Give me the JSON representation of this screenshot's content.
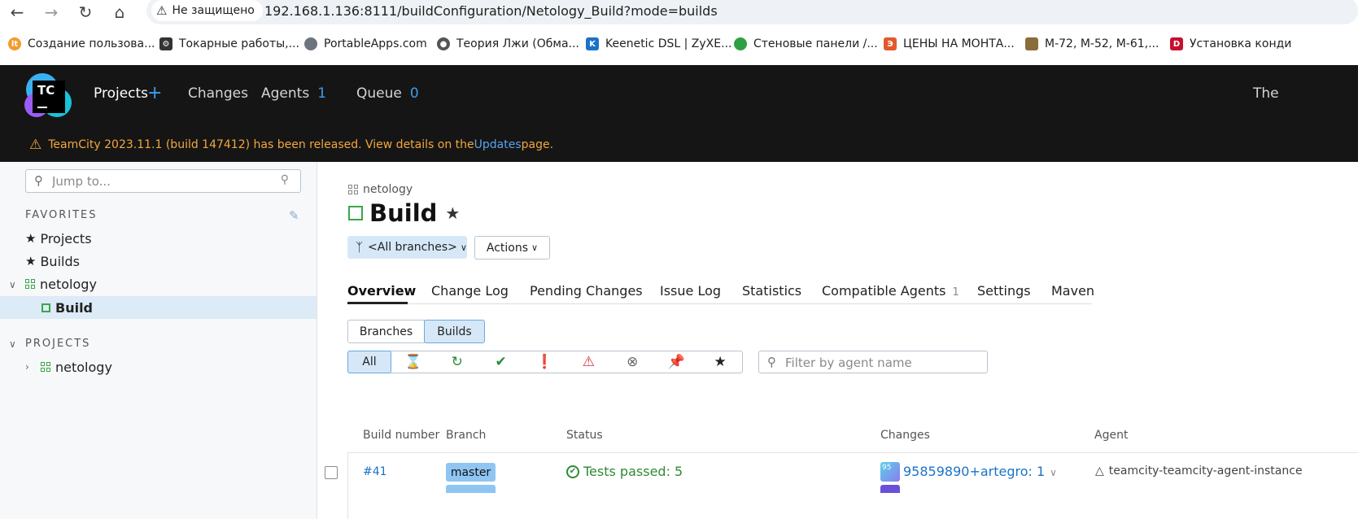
{
  "browser": {
    "security_label": "Не защищено",
    "url": "192.168.1.136:8111/buildConfiguration/Netology_Build?mode=builds",
    "bookmarks": [
      {
        "label": "Создание пользова...",
        "color": "#f39a2b",
        "icon": "lt-icon"
      },
      {
        "label": "Токарные работы,...",
        "color": "#333333",
        "icon": "lathe-icon"
      },
      {
        "label": "PortableApps.com",
        "color": "#6c7480",
        "icon": "portableapps-icon"
      },
      {
        "label": "Теория Лжи (Обма...",
        "color": "#555555",
        "icon": "globe-icon"
      },
      {
        "label": "Keenetic DSL | ZyXE...",
        "color": "#1a73c9",
        "icon": "keenetic-icon"
      },
      {
        "label": "Стеновые панели /...",
        "color": "#2ea043",
        "icon": "panel-icon"
      },
      {
        "label": "ЦЕНЫ НА МОНТА...",
        "color": "#e2592b",
        "icon": "price-icon"
      },
      {
        "label": "М-72, М-52, М-61,...",
        "color": "#8a6d3b",
        "icon": "moto-icon"
      },
      {
        "label": "Установка конди",
        "color": "#c8102e",
        "icon": "d-icon"
      }
    ]
  },
  "header": {
    "logo_text": "TC",
    "nav": [
      {
        "label": "Projects",
        "count": ""
      },
      {
        "label": "Changes",
        "count": ""
      },
      {
        "label": "Agents",
        "count": "1"
      },
      {
        "label": "Queue",
        "count": "0"
      }
    ],
    "right_text": "The"
  },
  "banner": {
    "text_before": "TeamCity 2023.11.1 (build 147412) has been released. View details on the ",
    "link": "Updates",
    "text_after": " page."
  },
  "sidebar": {
    "search_placeholder": "Jump to...",
    "favorites_label": "FAVORITES",
    "favorites": [
      "Projects",
      "Builds"
    ],
    "tree_project": "netology",
    "tree_build": "Build",
    "projects_label": "PROJECTS",
    "projects_item": "netology"
  },
  "main": {
    "breadcrumb": "netology",
    "title": "Build",
    "branch_selector": "<All branches>",
    "actions_label": "Actions",
    "tabs": [
      {
        "label": "Overview",
        "count": ""
      },
      {
        "label": "Change Log",
        "count": ""
      },
      {
        "label": "Pending Changes",
        "count": ""
      },
      {
        "label": "Issue Log",
        "count": ""
      },
      {
        "label": "Statistics",
        "count": ""
      },
      {
        "label": "Compatible Agents",
        "count": "1"
      },
      {
        "label": "Settings",
        "count": ""
      },
      {
        "label": "Maven",
        "count": ""
      }
    ],
    "view_toggle": {
      "branches": "Branches",
      "builds": "Builds"
    },
    "filter_all": "All",
    "agent_filter_placeholder": "Filter by agent name",
    "columns": [
      "Build number",
      "Branch",
      "Status",
      "Changes",
      "Agent"
    ],
    "rows": [
      {
        "number": "#41",
        "branch": "master",
        "status": "Tests passed: 5",
        "change_avatar": "95",
        "changes": "95859890+artegro: 1",
        "agent": "teamcity-teamcity-agent-instance"
      }
    ]
  }
}
